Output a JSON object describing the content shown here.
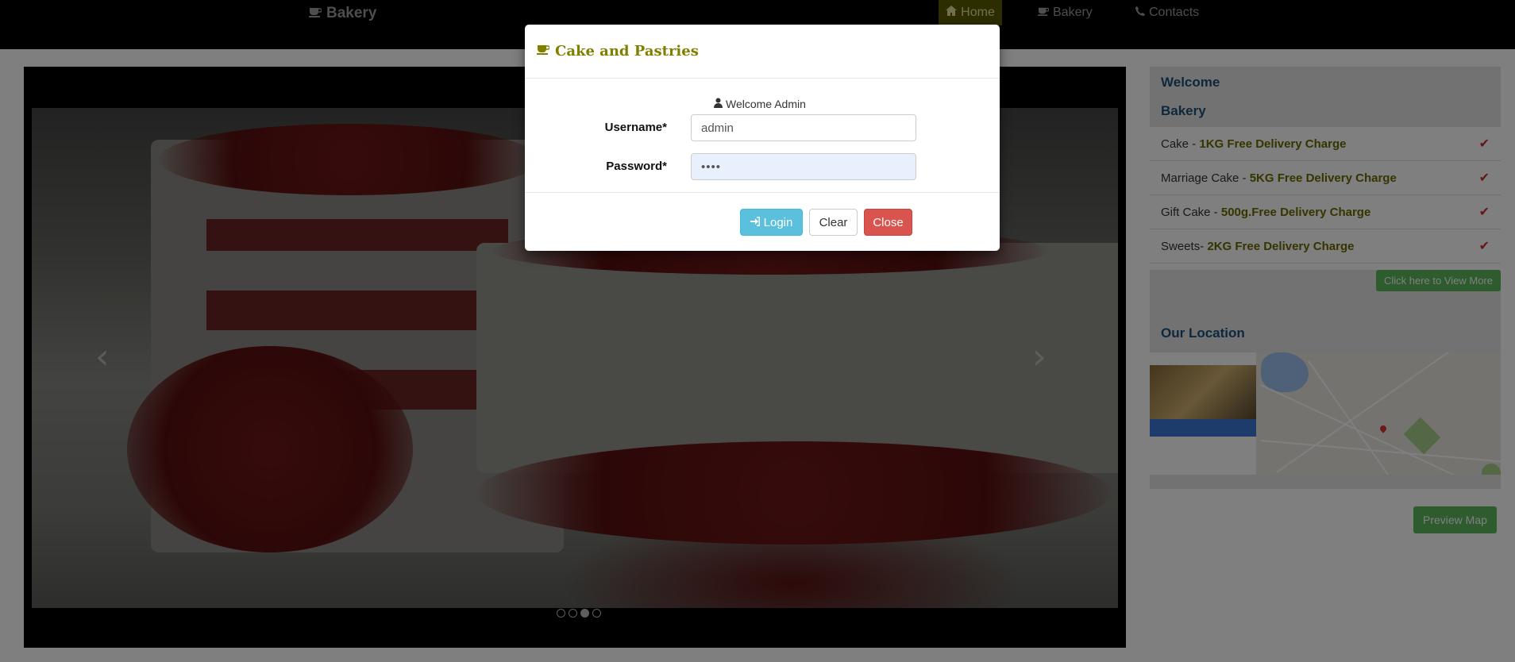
{
  "navbar": {
    "brand": "Bakery",
    "items": [
      {
        "label": "Home",
        "icon": "home-icon"
      },
      {
        "label": "Bakery",
        "icon": "coffee-cup-icon"
      },
      {
        "label": "Contacts",
        "icon": "phone-icon"
      }
    ]
  },
  "carousel": {
    "prev_icon": "chevron-left-icon",
    "next_icon": "chevron-right-icon",
    "indicator_count": 4,
    "active_index": 2
  },
  "sidebar": {
    "welcome_heading": "Welcome",
    "bakery_heading": "Bakery",
    "items": [
      {
        "name": "Cake - ",
        "offer": "1KG Free Delivery Charge"
      },
      {
        "name": "Marriage Cake - ",
        "offer": "5KG Free Delivery Charge"
      },
      {
        "name": "Gift Cake - ",
        "offer": "500g.Free Delivery Charge"
      },
      {
        "name": "Sweets- ",
        "offer": "2KG Free Delivery Charge"
      }
    ],
    "view_more_label": "Click here to View More",
    "location_heading": "Our Location",
    "preview_map_label": "Preview Map"
  },
  "modal": {
    "title": "Cake and Pastries",
    "welcome_text": "Welcome Admin",
    "username_label": "Username*",
    "username_value": "admin",
    "password_label": "Password*",
    "password_value": "••••",
    "login_label": "Login",
    "clear_label": "Clear",
    "close_label": "Close"
  },
  "colors": {
    "accent_olive": "#808000",
    "login_button": "#5bc0de",
    "close_button": "#d9534f",
    "success_green": "#5cb85c"
  }
}
